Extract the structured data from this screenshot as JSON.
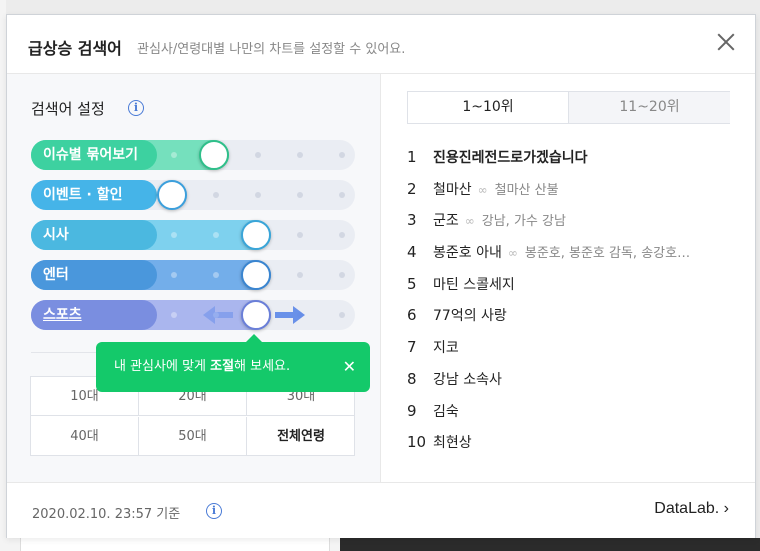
{
  "header": {
    "title": "급상승 검색어",
    "subtitle": "관심사/연령대별 나만의 차트를 설정할 수 있어요."
  },
  "settings": {
    "title": "검색어 설정",
    "sliders": [
      {
        "label": "이슈별 묶어보기",
        "level": 1,
        "color": "#3dd1a0"
      },
      {
        "label": "이벤트 · 할인",
        "level": 0,
        "color": "#45b4e8"
      },
      {
        "label": "시사",
        "level": 2,
        "color": "#4bb8e0"
      },
      {
        "label": "엔터",
        "level": 2,
        "color": "#4a97dc"
      },
      {
        "label": "스포츠",
        "level": 2,
        "color": "#7a8ee0"
      }
    ],
    "max_level": 5
  },
  "tooltip": {
    "text_before": "내 관심사에 맞게 ",
    "text_bold": "조절",
    "text_after": "해 보세요.",
    "close": "✕"
  },
  "ages": [
    "10대",
    "20대",
    "30대",
    "40대",
    "50대",
    "전체연령"
  ],
  "tabs": [
    "1~10위",
    "11~20위"
  ],
  "ranks": [
    {
      "num": "1",
      "text": "진용진레전드로가겠습니다",
      "related": ""
    },
    {
      "num": "2",
      "text": "철마산",
      "related": "철마산 산불"
    },
    {
      "num": "3",
      "text": "군조",
      "related": "강남, 가수 강남"
    },
    {
      "num": "4",
      "text": "봉준호 아내",
      "related": "봉준호, 봉준호 감독, 송강호…"
    },
    {
      "num": "5",
      "text": "마틴 스콜세지",
      "related": ""
    },
    {
      "num": "6",
      "text": "77억의 사랑",
      "related": ""
    },
    {
      "num": "7",
      "text": "지코",
      "related": ""
    },
    {
      "num": "8",
      "text": "강남 소속사",
      "related": ""
    },
    {
      "num": "9",
      "text": "김숙",
      "related": ""
    },
    {
      "num": "10",
      "text": "최현상",
      "related": ""
    }
  ],
  "footer": {
    "timestamp": "2020.02.10. 23:57 기준",
    "datalab": "DataLab. ›"
  }
}
